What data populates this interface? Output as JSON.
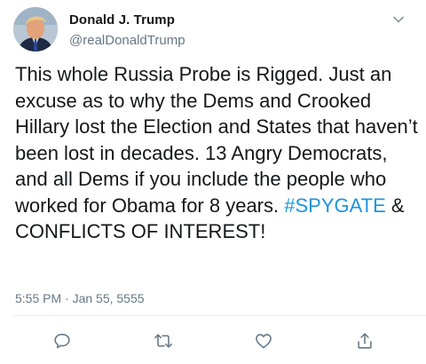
{
  "tweet": {
    "author": {
      "display_name": "Donald J. Trump",
      "handle": "@realDonaldTrump",
      "avatar_icon": "profile-photo"
    },
    "text_parts": [
      "This whole Russia Probe is Rigged. Just an excuse as to why the Dems and Crooked Hillary lost the Election and States that haven’t been lost in decades. 13 Angry Democrats, and all Dems if you include the people who worked for Obama for 8 years. ",
      "#SPYGATE",
      " & CONFLICTS OF INTEREST!"
    ],
    "timestamp": "5:55 PM · Jan 55, 5555",
    "menu_icon": "chevron-down-icon",
    "actions": [
      {
        "name": "reply",
        "icon": "reply-icon"
      },
      {
        "name": "retweet",
        "icon": "retweet-icon"
      },
      {
        "name": "like",
        "icon": "heart-icon"
      },
      {
        "name": "share",
        "icon": "share-icon"
      }
    ],
    "colors": {
      "text": "#14171a",
      "secondary": "#657786",
      "link": "#1b95e0",
      "divider": "#e6ecf0"
    }
  }
}
